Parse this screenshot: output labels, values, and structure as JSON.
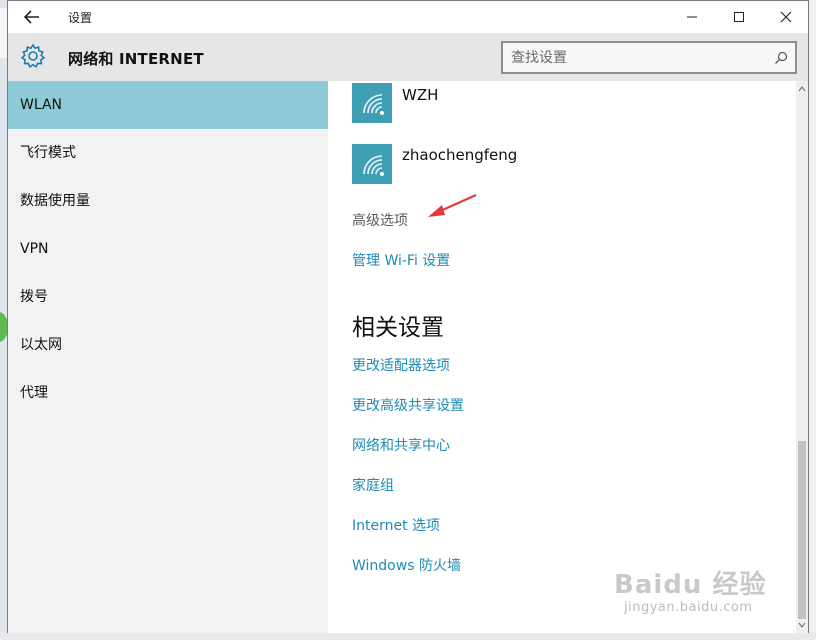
{
  "window": {
    "title": "设置",
    "controls": {
      "minimize": "minimize-icon",
      "maximize": "maximize-icon",
      "close": "close-icon"
    }
  },
  "header": {
    "section_title": "网络和 INTERNET",
    "search_placeholder": "查找设置"
  },
  "sidebar": {
    "items": [
      {
        "label": "WLAN",
        "active": true
      },
      {
        "label": "飞行模式"
      },
      {
        "label": "数据使用量"
      },
      {
        "label": "VPN"
      },
      {
        "label": "拨号"
      },
      {
        "label": "以太网"
      },
      {
        "label": "代理"
      }
    ]
  },
  "content": {
    "networks": [
      {
        "name": "WZH",
        "icon": "wifi-signal-icon"
      },
      {
        "name": "zhaochengfeng",
        "icon": "wifi-signal-icon"
      }
    ],
    "advanced_label": "高级选项",
    "manage_wifi_link": "管理 Wi-Fi 设置",
    "related_title": "相关设置",
    "related_links": [
      "更改适配器选项",
      "更改高级共享设置",
      "网络和共享中心",
      "家庭组",
      "Internet 选项",
      "Windows 防火墙"
    ]
  },
  "watermark": {
    "main": "Baidu 经验",
    "sub": "jingyan.baidu.com"
  },
  "colors": {
    "accent_link": "#1e8bb3",
    "active_nav": "#8ecbd9",
    "wifi_tile": "#3f9fb5",
    "annotation_arrow": "#e23b3b"
  }
}
